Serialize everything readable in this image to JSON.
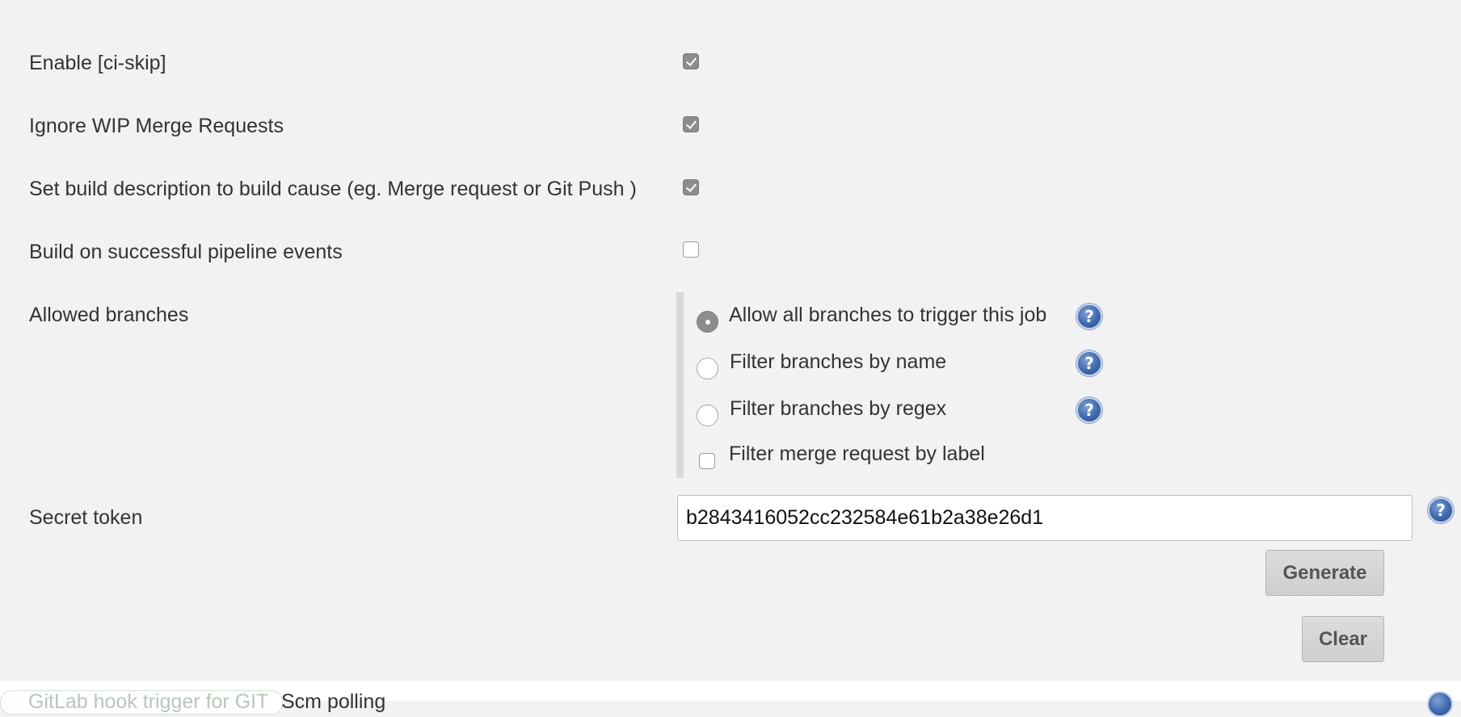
{
  "options": [
    {
      "label": "Enable [ci-skip]",
      "checked": true
    },
    {
      "label": "Ignore WIP Merge Requests",
      "checked": true
    },
    {
      "label": "Set build description to build cause (eg. Merge request or Git Push )",
      "checked": true
    },
    {
      "label": "Build on successful pipeline events",
      "checked": false
    }
  ],
  "allowed_branches": {
    "label": "Allowed branches",
    "choices": [
      {
        "label": "Allow all branches to trigger this job",
        "selected": true
      },
      {
        "label": "Filter branches by name",
        "selected": false
      },
      {
        "label": "Filter branches by regex",
        "selected": false
      }
    ],
    "filter_label": {
      "label": "Filter merge request by label",
      "checked": false
    }
  },
  "secret_token": {
    "label": "Secret token",
    "value": "b2843416052cc232584e61b2a38e26d1",
    "generate_label": "Generate",
    "clear_label": "Clear"
  },
  "help_icon_glyph": "?",
  "bottom": {
    "faded_text": "GitLab hook trigger for GIT",
    "text": "Scm polling"
  }
}
